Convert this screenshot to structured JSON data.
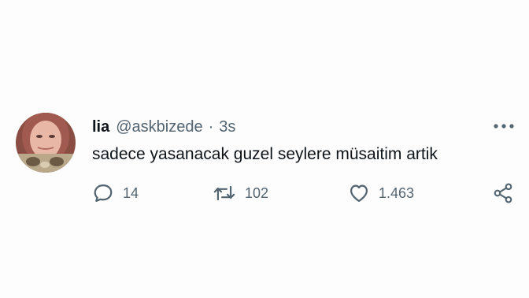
{
  "tweet": {
    "display_name": "lia",
    "handle": "@askbizede",
    "separator": "·",
    "time": "3s",
    "text": "sadece yasanacak guzel seylere müsaitim artik",
    "actions": {
      "reply": {
        "icon": "reply-icon",
        "count": "14"
      },
      "retweet": {
        "icon": "retweet-icon",
        "count": "102"
      },
      "like": {
        "icon": "heart-icon",
        "count": "1.463"
      },
      "share": {
        "icon": "share-icon"
      }
    },
    "more_icon": "more-options-icon"
  },
  "colors": {
    "text_primary": "#0f1419",
    "text_secondary": "#536471",
    "background": "#fdfdfd"
  }
}
